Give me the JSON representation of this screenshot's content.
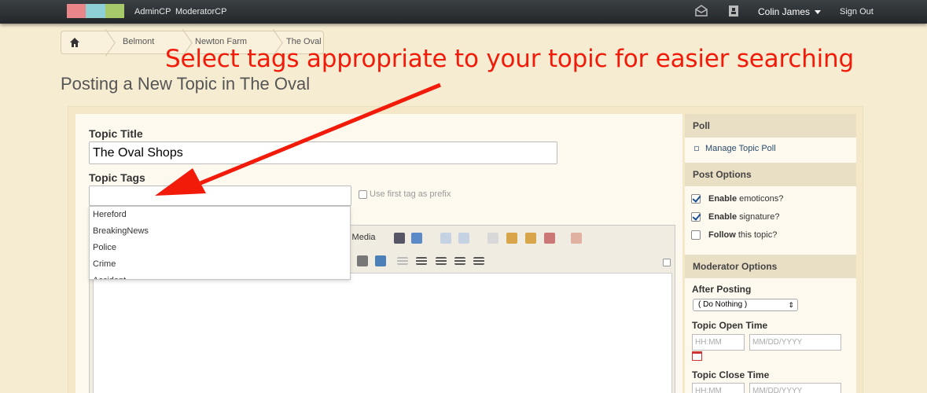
{
  "topbar": {
    "links": [
      "AdminCP",
      "ModeratorCP"
    ],
    "user_name": "Colin James",
    "sign_out": "Sign Out",
    "logo_colors": [
      "#e9868a",
      "#8fcfd6",
      "#a7c96a"
    ]
  },
  "breadcrumb": {
    "items": [
      "Belmont",
      "Newton Farm",
      "The Oval"
    ]
  },
  "annotation": {
    "text": "Select tags appropriate to your topic for easier searching",
    "color": "#f21b0a"
  },
  "page_title": "Posting a New Topic in The Oval",
  "form": {
    "title_label": "Topic Title",
    "title_value": "The Oval Shops",
    "tags_label": "Topic Tags",
    "tags_value": "",
    "prefix_label": "Use first tag as prefix",
    "tag_suggestions": [
      "Hereford",
      "BreakingNews",
      "Police",
      "Crime",
      "Accident"
    ],
    "toolbar_media_label": "y Media"
  },
  "sidebar": {
    "poll_header": "Poll",
    "manage_poll": "Manage Topic Poll",
    "post_options_header": "Post Options",
    "options": [
      {
        "bold": "Enable",
        "rest": "emoticons?",
        "checked": true
      },
      {
        "bold": "Enable",
        "rest": "signature?",
        "checked": true
      },
      {
        "bold": "Follow",
        "rest": "this topic?",
        "checked": false
      }
    ],
    "moderator_header": "Moderator Options",
    "after_posting_label": "After Posting",
    "after_posting_value": "( Do Nothing )",
    "open_time_label": "Topic Open Time",
    "close_time_label": "Topic Close Time",
    "time_placeholder": "HH:MM",
    "date_placeholder": "MM/DD/YYYY"
  }
}
